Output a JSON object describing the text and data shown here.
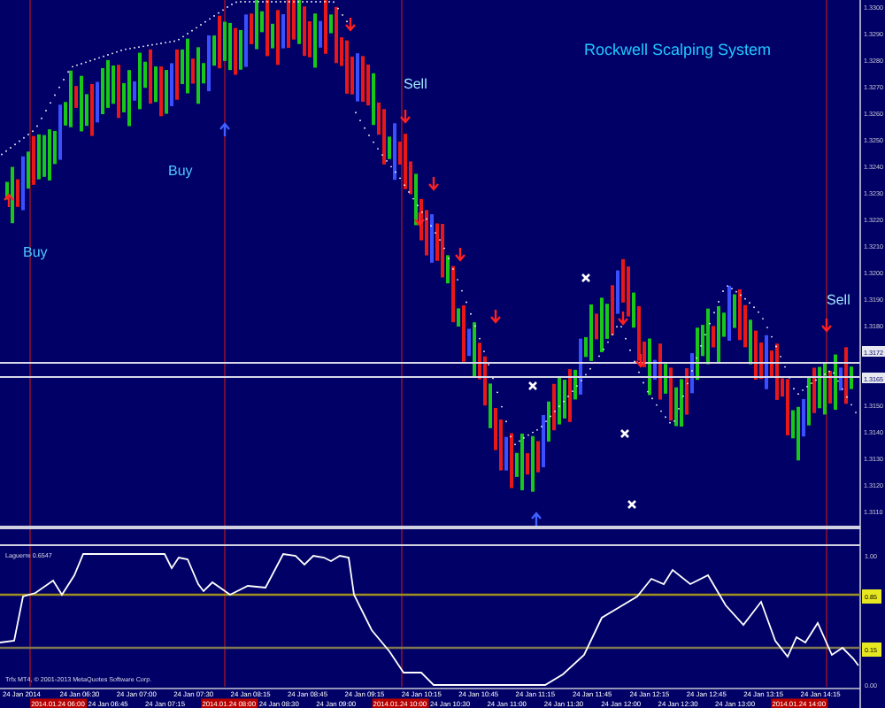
{
  "chart": {
    "title": "Rockwell Scalping System",
    "signals": [
      {
        "text": "Buy",
        "kind": "buy"
      },
      {
        "text": "Buy",
        "kind": "buy"
      },
      {
        "text": "Sell",
        "kind": "sell"
      },
      {
        "text": "Sell",
        "kind": "sell"
      }
    ],
    "price_labels": [
      {
        "text": "1.3300",
        "highlighted": false
      },
      {
        "text": "1.3290",
        "highlighted": false
      },
      {
        "text": "1.3280",
        "highlighted": false
      },
      {
        "text": "1.3270",
        "highlighted": false
      },
      {
        "text": "1.3260",
        "highlighted": false
      },
      {
        "text": "1.3250",
        "highlighted": false
      },
      {
        "text": "1.3240",
        "highlighted": false
      },
      {
        "text": "1.3230",
        "highlighted": false
      },
      {
        "text": "1.3220",
        "highlighted": false
      },
      {
        "text": "1.3210",
        "highlighted": false
      },
      {
        "text": "1.3200",
        "highlighted": false
      },
      {
        "text": "1.3190",
        "highlighted": false
      },
      {
        "text": "1.3180",
        "highlighted": false
      },
      {
        "text": "1.3172",
        "highlighted": true
      },
      {
        "text": "1.3165",
        "highlighted": true
      },
      {
        "text": "1.3150",
        "highlighted": false
      },
      {
        "text": "1.3140",
        "highlighted": false
      },
      {
        "text": "1.3130",
        "highlighted": false
      },
      {
        "text": "1.3120",
        "highlighted": false
      },
      {
        "text": "1.3110",
        "highlighted": false
      }
    ]
  },
  "indicator": {
    "title": "Laguerre 0.6547",
    "copyright": "Trfx MT4, © 2001-2013 MetaQuotes Software Corp.",
    "axis_labels": [
      {
        "text": "1.00",
        "kind": "plain"
      },
      {
        "text": "0.85",
        "kind": "level"
      },
      {
        "text": "0.15",
        "kind": "level"
      },
      {
        "text": "0.00",
        "kind": "plain"
      }
    ]
  },
  "time_axis": {
    "labels": [
      {
        "text": "24 Jan 2014",
        "highlighted": false
      },
      {
        "text": "24 Jan 06:30",
        "highlighted": false
      },
      {
        "text": "24 Jan 07:00",
        "highlighted": false
      },
      {
        "text": "24 Jan 07:30",
        "highlighted": false
      },
      {
        "text": "24 Jan 08:15",
        "highlighted": false
      },
      {
        "text": "24 Jan 08:45",
        "highlighted": false
      },
      {
        "text": "24 Jan 09:15",
        "highlighted": false
      },
      {
        "text": "24 Jan 10:15",
        "highlighted": false
      },
      {
        "text": "24 Jan 10:45",
        "highlighted": false
      },
      {
        "text": "24 Jan 11:15",
        "highlighted": false
      },
      {
        "text": "24 Jan 11:45",
        "highlighted": false
      },
      {
        "text": "24 Jan 12:15",
        "highlighted": false
      },
      {
        "text": "24 Jan 12:45",
        "highlighted": false
      },
      {
        "text": "24 Jan 13:15",
        "highlighted": false
      },
      {
        "text": "24 Jan 14:15",
        "highlighted": false
      },
      {
        "text": "2014.01.24 06:00",
        "highlighted": true
      },
      {
        "text": "24 Jan 06:45",
        "highlighted": false
      },
      {
        "text": "24 Jan 07:15",
        "highlighted": false
      },
      {
        "text": "2014.01.24 08:00",
        "highlighted": true
      },
      {
        "text": "24 Jan 08:30",
        "highlighted": false
      },
      {
        "text": "24 Jan 09:00",
        "highlighted": false
      },
      {
        "text": "2014.01.24 10:00",
        "highlighted": true
      },
      {
        "text": "24 Jan 10:30",
        "highlighted": false
      },
      {
        "text": "24 Jan 11:00",
        "highlighted": false
      },
      {
        "text": "24 Jan 11:30",
        "highlighted": false
      },
      {
        "text": "24 Jan 12:00",
        "highlighted": false
      },
      {
        "text": "24 Jan 12:30",
        "highlighted": false
      },
      {
        "text": "24 Jan 13:00",
        "highlighted": false
      },
      {
        "text": "2014.01.24 14:00",
        "highlighted": true
      }
    ]
  }
}
